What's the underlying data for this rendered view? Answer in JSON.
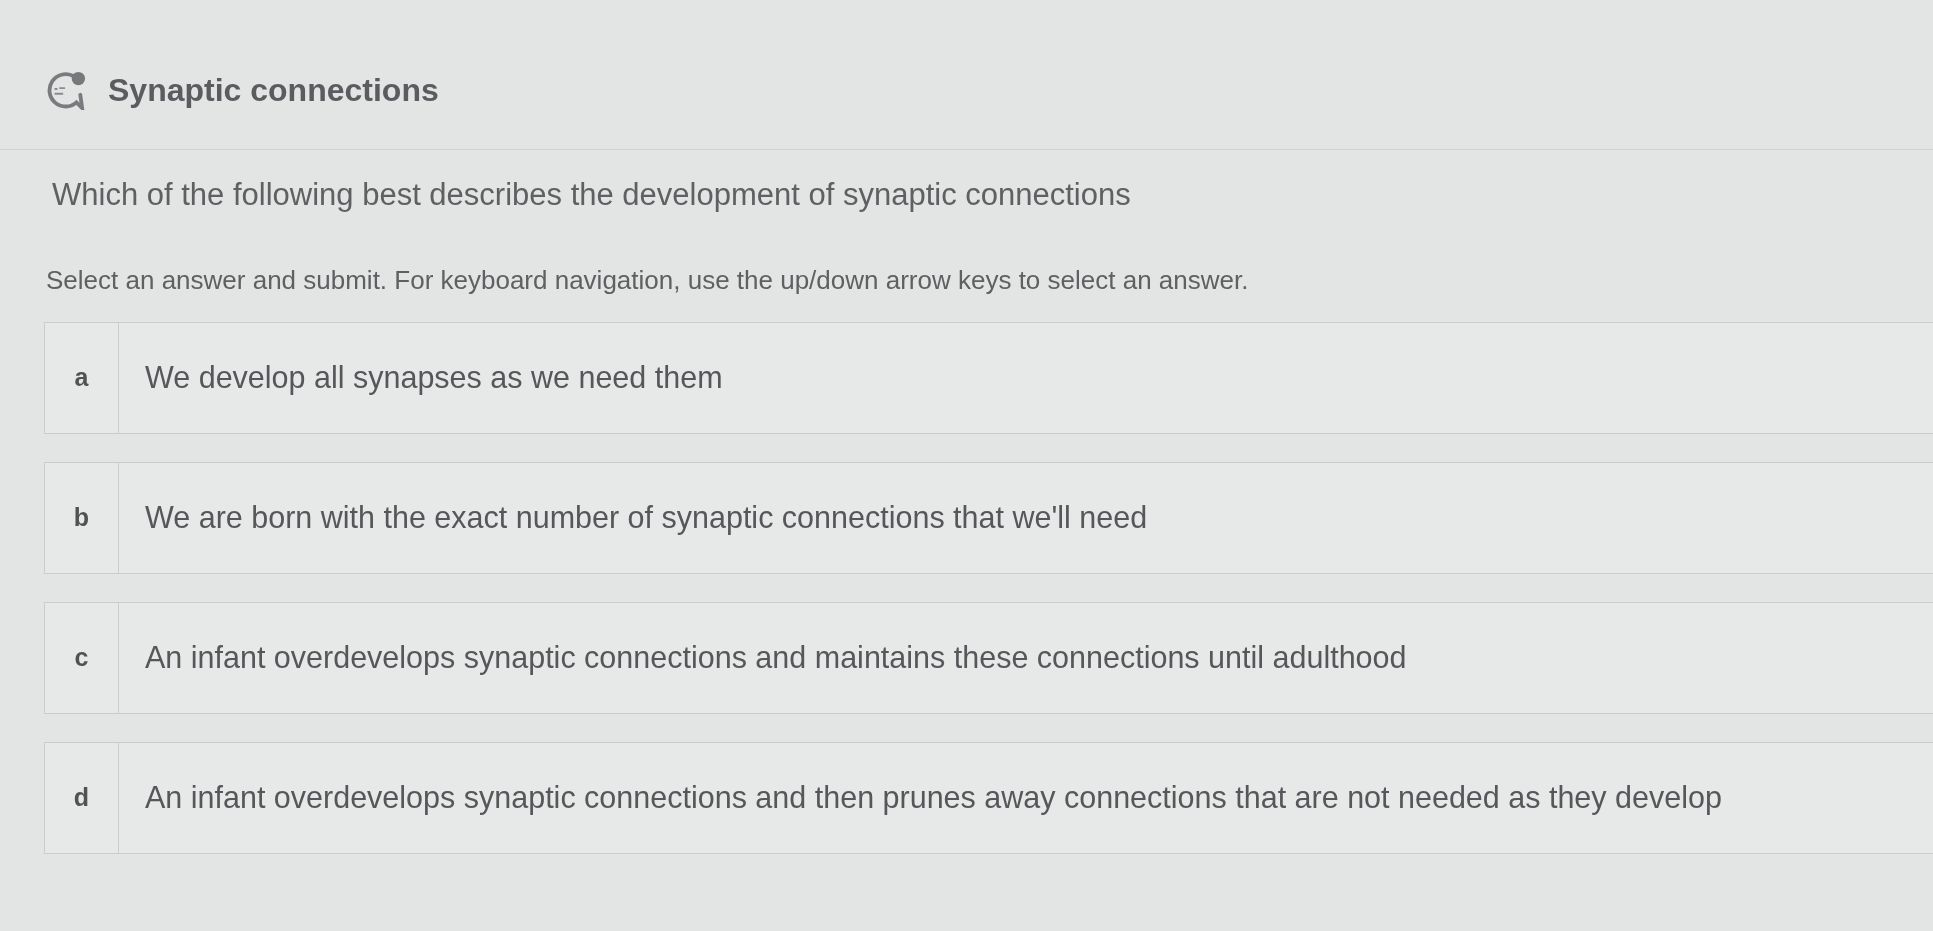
{
  "header": {
    "title": "Synaptic connections"
  },
  "question": {
    "text": "Which of the following best describes the development of synaptic connections",
    "instructions": "Select an answer and submit. For keyboard navigation, use the up/down arrow keys to select an answer."
  },
  "options": [
    {
      "letter": "a",
      "text": "We develop all synapses as we need them",
      "selected": false
    },
    {
      "letter": "b",
      "text": "We are born with the exact number of synaptic connections that we'll need",
      "selected": false
    },
    {
      "letter": "c",
      "text": "An infant overdevelops synaptic connections and maintains these connections until adulthood",
      "selected": false
    },
    {
      "letter": "d",
      "text": "An infant overdevelops synaptic connections and then prunes away connections that are not needed as they develop",
      "selected": false
    }
  ]
}
